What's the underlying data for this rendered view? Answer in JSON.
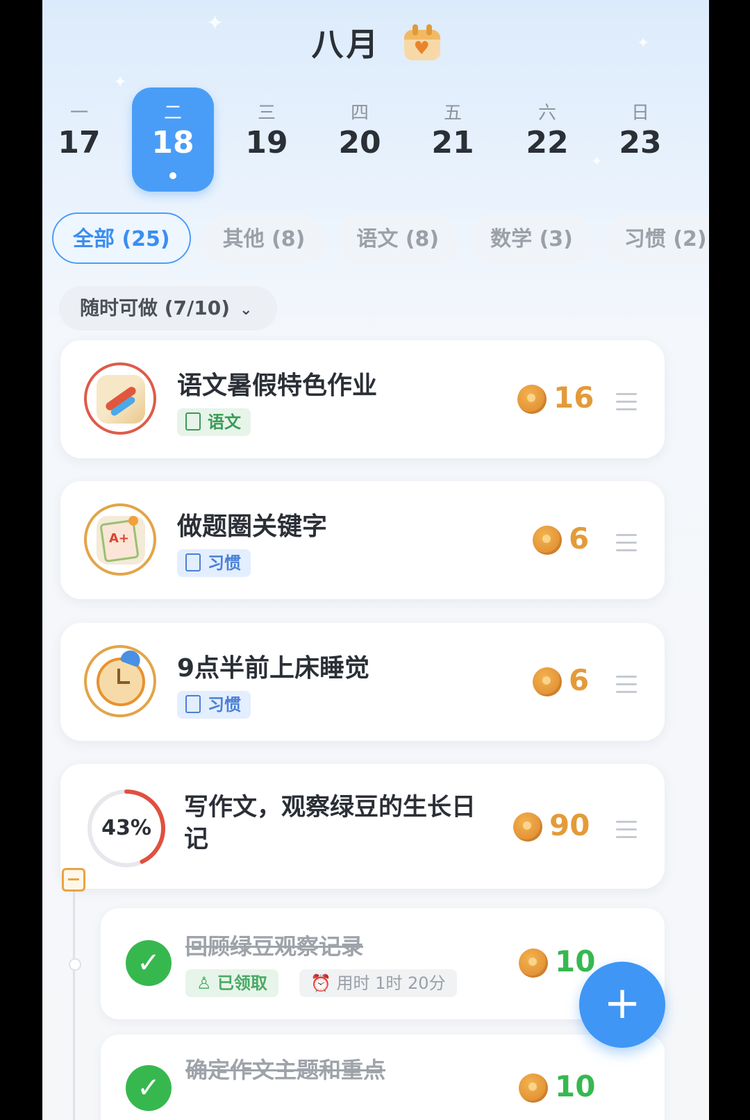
{
  "header": {
    "month": "八月"
  },
  "week": [
    {
      "wd": "一",
      "num": "17"
    },
    {
      "wd": "二",
      "num": "18",
      "active": true
    },
    {
      "wd": "三",
      "num": "19"
    },
    {
      "wd": "四",
      "num": "20"
    },
    {
      "wd": "五",
      "num": "21"
    },
    {
      "wd": "六",
      "num": "22"
    },
    {
      "wd": "日",
      "num": "23"
    }
  ],
  "tabs": [
    "全部 (25)",
    "其他 (8)",
    "语文 (8)",
    "数学 (3)",
    "习惯 (2)"
  ],
  "filter": {
    "label": "随时可做 (7/10)"
  },
  "tasks": [
    {
      "title": "语文暑假特色作业",
      "tag": "语文",
      "points": "16",
      "icon": "book-pencil-icon"
    },
    {
      "title": "做题圈关键字",
      "tag": "习惯",
      "points": "6",
      "icon": "exam-paper-icon"
    },
    {
      "title": "9点半前上床睡觉",
      "tag": "习惯",
      "points": "6",
      "icon": "alarm-clock-icon"
    }
  ],
  "project": {
    "title_line1": "写作文，观察绿豆的生长日",
    "title_line2": "记",
    "progress": "43%",
    "progress_value": 43,
    "points": "90"
  },
  "subtasks": [
    {
      "title": "回顾绿豆观察记录",
      "status": "已领取",
      "time": "用时 1时 20分",
      "points": "10"
    },
    {
      "title": "确定作文主题和重点",
      "points": "10"
    }
  ],
  "colors": {
    "accent": "#4a9df6",
    "coin": "#e39b3a",
    "done": "#37b84f"
  }
}
